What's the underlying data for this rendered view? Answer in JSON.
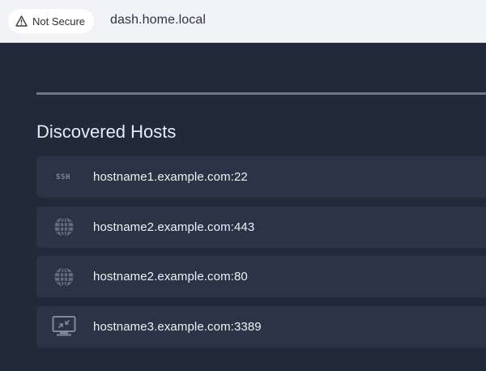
{
  "browser": {
    "security_label": "Not Secure",
    "url": "dash.home.local"
  },
  "main": {
    "section_title": "Discovered Hosts",
    "hosts": [
      {
        "icon": "ssh-icon",
        "icon_text": "SSH",
        "label": "hostname1.example.com:22"
      },
      {
        "icon": "globe-icon",
        "label": "hostname2.example.com:443"
      },
      {
        "icon": "globe-icon",
        "label": "hostname2.example.com:80"
      },
      {
        "icon": "remote-desktop-icon",
        "label": "hostname3.example.com:3389"
      }
    ]
  },
  "colors": {
    "background": "#222a3a",
    "row": "#2b3446",
    "text": "#eef1f6",
    "icon": "#7f8898"
  }
}
